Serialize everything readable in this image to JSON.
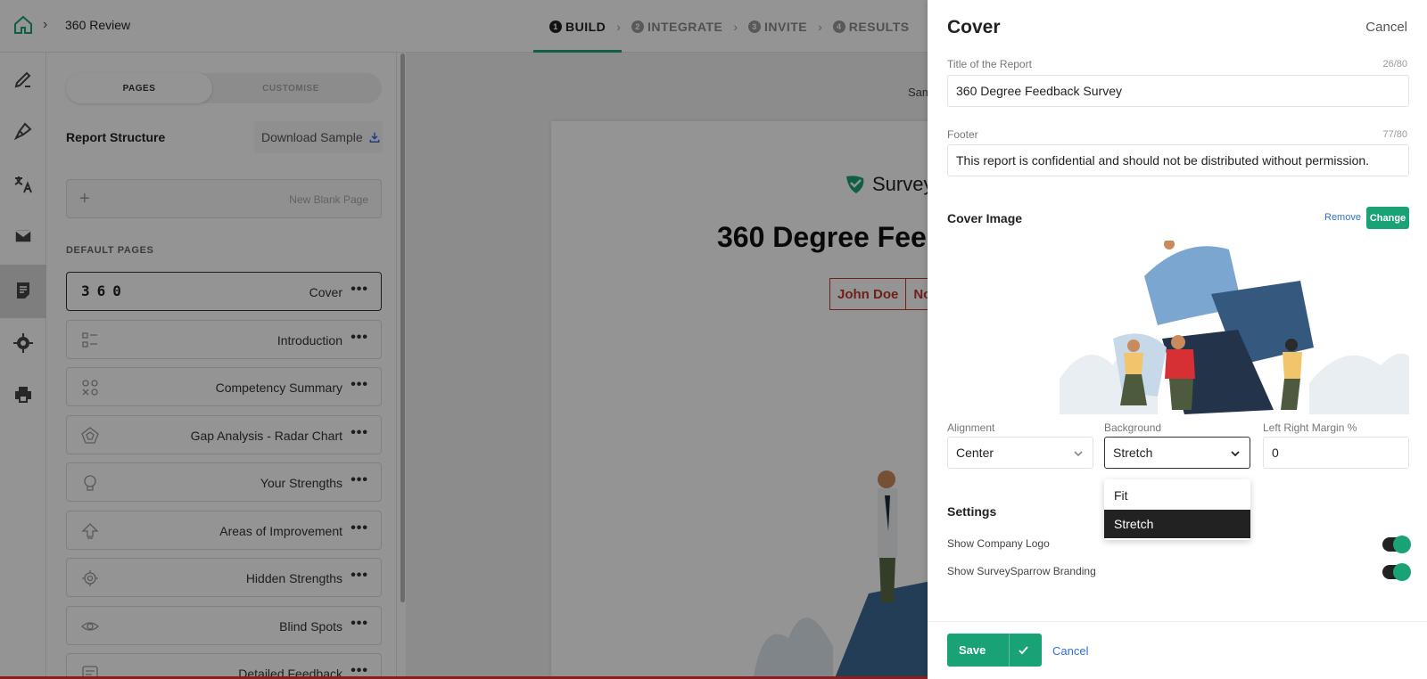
{
  "header": {
    "breadcrumb_title": "360 Review",
    "steps": [
      {
        "num": "1",
        "label": "BUILD"
      },
      {
        "num": "2",
        "label": "INTEGRATE"
      },
      {
        "num": "3",
        "label": "INVITE"
      },
      {
        "num": "4",
        "label": "RESULTS"
      }
    ]
  },
  "pages_panel": {
    "tabs": {
      "pages": "PAGES",
      "customise": "CUSTOMISE"
    },
    "report_structure": "Report Structure",
    "download_sample": "Download Sample",
    "new_blank_page": "New Blank Page",
    "default_pages_heading": "DEFAULT PAGES",
    "items": [
      {
        "label": "Cover",
        "icon_text": "360"
      },
      {
        "label": "Introduction"
      },
      {
        "label": "Competency Summary"
      },
      {
        "label": "Gap Analysis - Radar Chart"
      },
      {
        "label": "Your Strengths"
      },
      {
        "label": "Areas of Improvement"
      },
      {
        "label": "Hidden Strengths"
      },
      {
        "label": "Blind Spots"
      },
      {
        "label": "Detailed Feedback"
      }
    ],
    "more_glyph": "•••"
  },
  "preview": {
    "sample_label": "Sam",
    "logo_text": "SurveyS",
    "title": "360 Degree Fee",
    "names": [
      "John Doe",
      "No"
    ]
  },
  "drawer": {
    "title": "Cover",
    "cancel_top": "Cancel",
    "report_title": {
      "label": "Title of the Report",
      "count": "26/80",
      "value": "360 Degree Feedback Survey"
    },
    "footer": {
      "label": "Footer",
      "count": "77/80",
      "value": "This report is confidential and should not be distributed without permission."
    },
    "cover_image": {
      "heading": "Cover Image",
      "remove": "Remove",
      "change": "Change"
    },
    "alignment": {
      "label": "Alignment",
      "value": "Center"
    },
    "background": {
      "label": "Background",
      "value": "Stretch",
      "options": [
        "Fit",
        "Stretch"
      ],
      "selected": "Stretch"
    },
    "margin": {
      "label": "Left Right Margin %",
      "value": "0"
    },
    "settings_heading": "Settings",
    "toggles": [
      {
        "label": "Show Company Logo",
        "on": true
      },
      {
        "label": "Show SurveySparrow Branding",
        "on": true
      }
    ],
    "save": "Save",
    "cancel_bottom": "Cancel"
  },
  "colors": {
    "accent": "#1aa277",
    "link": "#2f6fd6",
    "danger": "#c0392b"
  }
}
